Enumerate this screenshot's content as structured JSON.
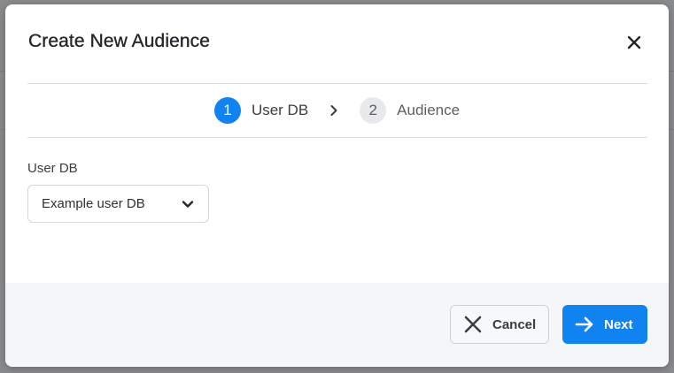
{
  "modal": {
    "title": "Create New Audience",
    "close_icon": "close-icon"
  },
  "stepper": {
    "steps": [
      {
        "number": "1",
        "label": "User DB",
        "state": "active"
      },
      {
        "number": "2",
        "label": "Audience",
        "state": "inactive"
      }
    ],
    "separator_icon": "chevron-right-icon"
  },
  "form": {
    "user_db": {
      "label": "User DB",
      "value": "Example user DB",
      "caret_icon": "chevron-down-icon"
    }
  },
  "footer": {
    "cancel_label": "Cancel",
    "cancel_icon": "close-icon",
    "next_label": "Next",
    "next_icon": "arrow-right-icon"
  },
  "colors": {
    "accent": "#1083f0",
    "overlay": "#8a8b8d",
    "footer_bg": "#f5f6f8"
  }
}
